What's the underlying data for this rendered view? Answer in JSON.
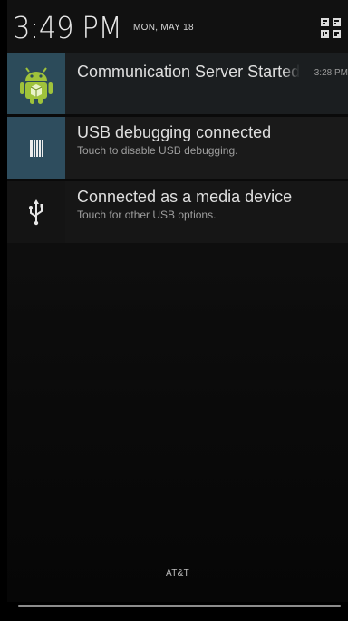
{
  "header": {
    "time": "3:49 PM",
    "date": "MON, MAY 18"
  },
  "notifications": [
    {
      "title": "Communication Server Started",
      "time": "3:28 PM",
      "text": "",
      "icon": "android-robot-icon"
    },
    {
      "title": "USB debugging connected",
      "time": "",
      "text": "Touch to disable USB debugging.",
      "icon": "usb-debugging-icon"
    },
    {
      "title": "Connected as a media device",
      "time": "",
      "text": "Touch for other USB options.",
      "icon": "usb-icon"
    }
  ],
  "footer": {
    "carrier": "AT&T"
  },
  "colors": {
    "icon_highlight": "#2c4b5a",
    "android_green": "#9fc33b"
  }
}
